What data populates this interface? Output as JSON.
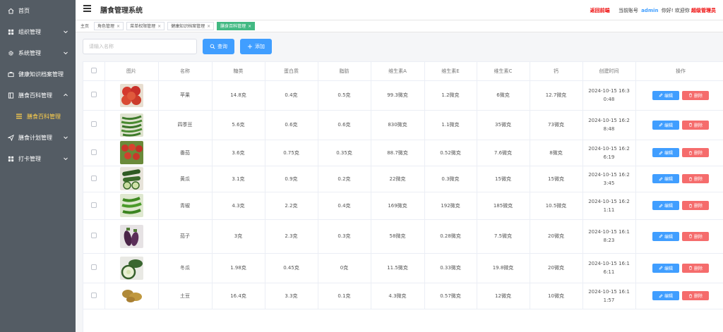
{
  "sidebar": {
    "items": [
      {
        "label": "首页",
        "icon": "home-icon"
      },
      {
        "label": "组织管理",
        "icon": "grid-icon"
      },
      {
        "label": "系统管理",
        "icon": "gear-icon"
      },
      {
        "label": "健康知识档案管理",
        "icon": "briefcase-icon"
      },
      {
        "label": "膳食百科管理",
        "icon": "book-icon"
      },
      {
        "label": "膳食计划管理",
        "icon": "send-icon"
      },
      {
        "label": "打卡管理",
        "icon": "grid-icon"
      }
    ],
    "active_sub": {
      "label": "膳食百科管理",
      "icon": "list-icon"
    },
    "colors": {
      "bg": "#545c64",
      "active": "#ffd04b"
    }
  },
  "header": {
    "title": "膳食管理系统",
    "back_link": "返回前端",
    "account_prefix": "当前账号",
    "username": "admin",
    "greeting": "你好! 欢迎你",
    "role": "超级管理员"
  },
  "tags": [
    {
      "label": "主页",
      "closable": false,
      "active": false
    },
    {
      "label": "角色管理",
      "closable": true,
      "active": false
    },
    {
      "label": "菜单权限管理",
      "closable": true,
      "active": false
    },
    {
      "label": "健康知识档案管理",
      "closable": true,
      "active": false
    },
    {
      "label": "膳食百科管理",
      "closable": true,
      "active": true
    }
  ],
  "toolbar": {
    "search_placeholder": "请输入名称",
    "search_button": "查询",
    "add_button": "添加"
  },
  "table": {
    "headers": [
      "图片",
      "名称",
      "糖类",
      "蛋白质",
      "脂肪",
      "维生素A",
      "维生素E",
      "维生素C",
      "钙",
      "创建时间",
      "操作"
    ],
    "edit_label": "编辑",
    "delete_label": "删除",
    "rows": [
      {
        "name": "苹果",
        "sugar": "14.8克",
        "protein": "0.4克",
        "fat": "0.5克",
        "va": "99.3微克",
        "ve": "1.2微克",
        "vc": "6微克",
        "ca": "12.7微克",
        "time1": "2024-10-15 16:3",
        "time2": "0:48",
        "image": "apple"
      },
      {
        "name": "四季豆",
        "sugar": "5.6克",
        "protein": "0.6克",
        "fat": "0.6克",
        "va": "830微克",
        "ve": "1.1微克",
        "vc": "35微克",
        "ca": "73微克",
        "time1": "2024-10-15 16:2",
        "time2": "8:48",
        "image": "beans"
      },
      {
        "name": "番茄",
        "sugar": "3.6克",
        "protein": "0.75克",
        "fat": "0.35克",
        "va": "88.7微克",
        "ve": "0.52微克",
        "vc": "7.6微克",
        "ca": "8微克",
        "time1": "2024-10-15 16:2",
        "time2": "6:19",
        "image": "tomato"
      },
      {
        "name": "黄瓜",
        "sugar": "3.1克",
        "protein": "0.9克",
        "fat": "0.2克",
        "va": "22微克",
        "ve": "0.3微克",
        "vc": "15微克",
        "ca": "15微克",
        "time1": "2024-10-15 16:2",
        "time2": "3:45",
        "image": "cucumber"
      },
      {
        "name": "青椒",
        "sugar": "4.3克",
        "protein": "2.2克",
        "fat": "0.4克",
        "va": "169微克",
        "ve": "192微克",
        "vc": "185微克",
        "ca": "10.5微克",
        "time1": "2024-10-15 16:2",
        "time2": "1:11",
        "image": "pepper"
      },
      {
        "name": "茄子",
        "sugar": "3克",
        "protein": "2.3克",
        "fat": "0.3克",
        "va": "58微克",
        "ve": "0.28微克",
        "vc": "7.5微克",
        "ca": "20微克",
        "time1": "2024-10-15 16:1",
        "time2": "8:23",
        "image": "eggplant"
      },
      {
        "name": "冬瓜",
        "sugar": "1.98克",
        "protein": "0.45克",
        "fat": "0克",
        "va": "11.5微克",
        "ve": "0.33微克",
        "vc": "19.8微克",
        "ca": "20微克",
        "time1": "2024-10-15 16:1",
        "time2": "6:11",
        "image": "wintermelon"
      },
      {
        "name": "土豆",
        "sugar": "16.4克",
        "protein": "3.3克",
        "fat": "0.1克",
        "va": "4.3微克",
        "ve": "0.57微克",
        "vc": "12微克",
        "ca": "10微克",
        "time1": "2024-10-15 16:1",
        "time2": "1:57",
        "image": "potato"
      }
    ]
  },
  "colors": {
    "primary": "#409eff",
    "danger": "#f56c6c",
    "tag_active": "#42b983"
  }
}
